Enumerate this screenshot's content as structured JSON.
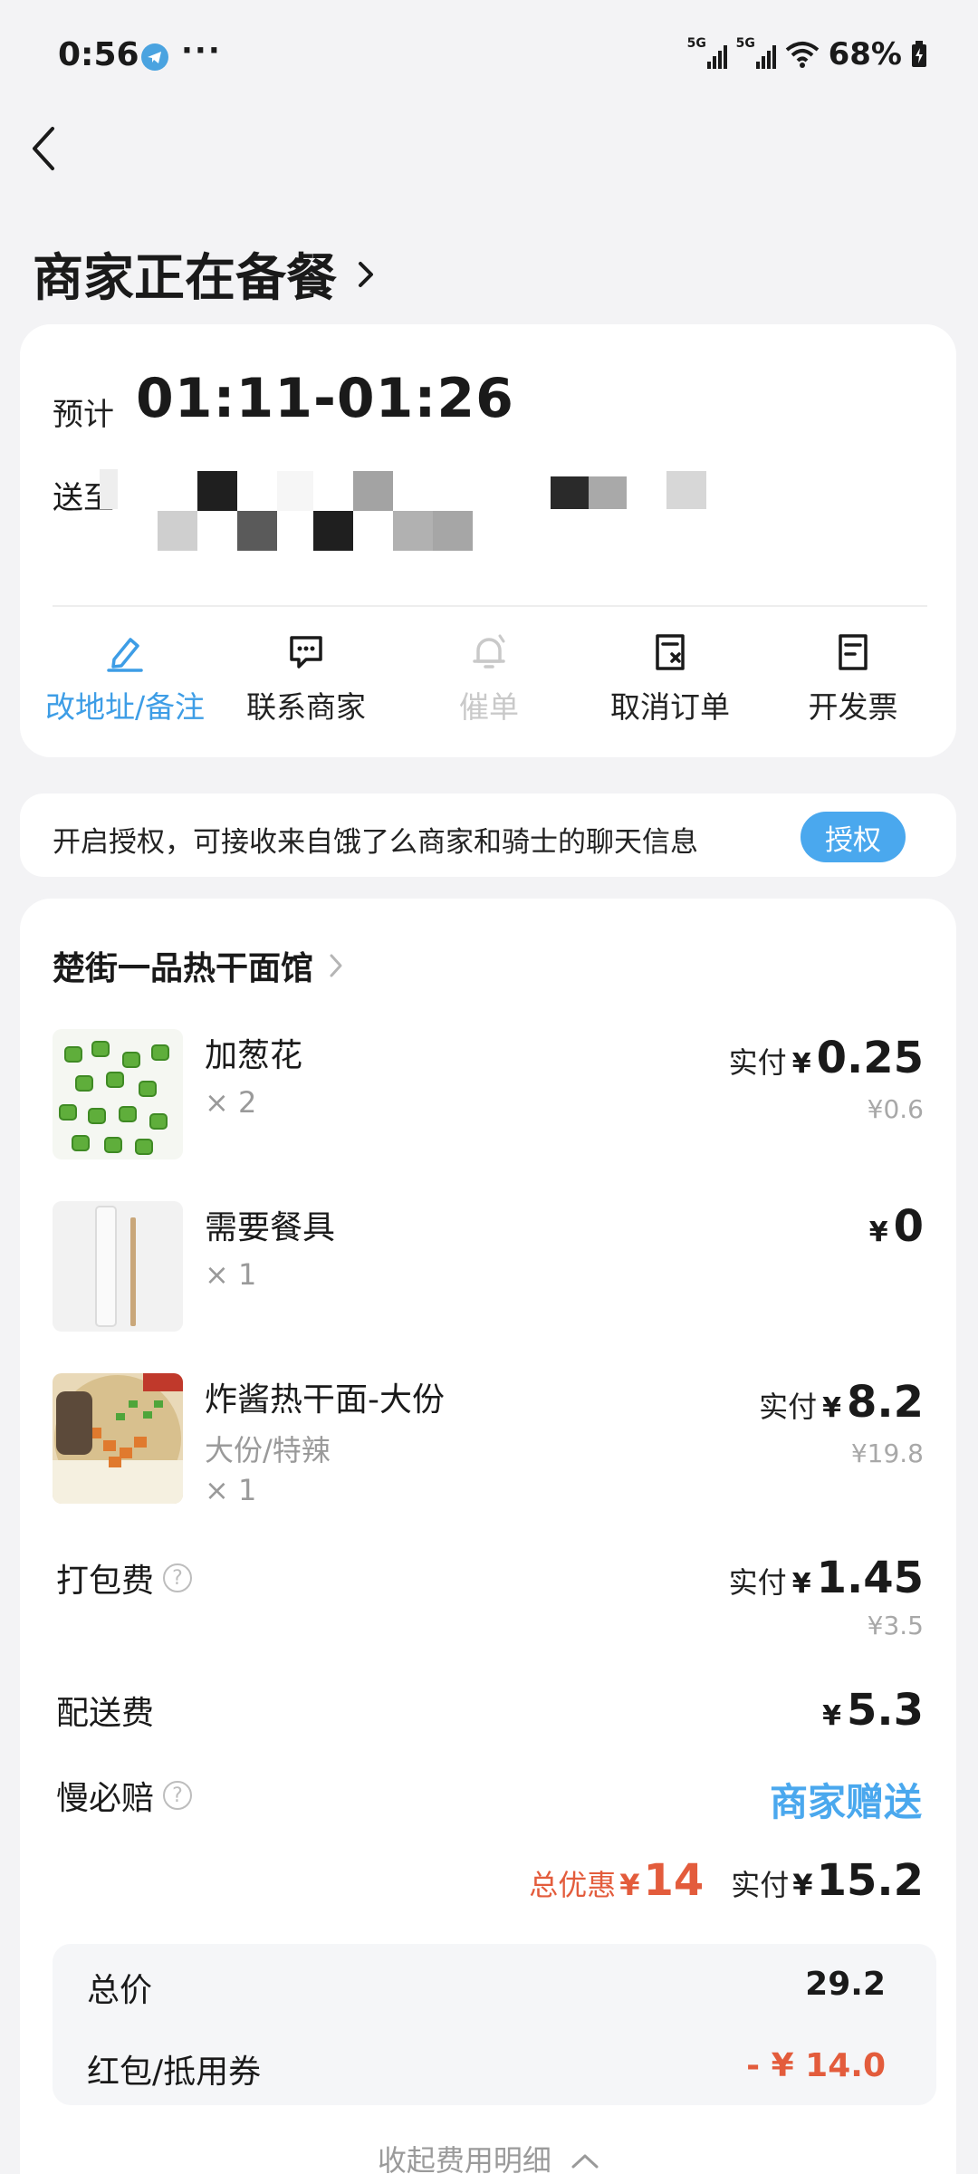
{
  "status_bar": {
    "time": "0:56",
    "more": "···",
    "signal1_tag": "5G",
    "signal2_tag": "5G",
    "battery": "68%",
    "icons": [
      "telegram-icon",
      "signal-icon",
      "wifi-icon",
      "battery-charging-icon"
    ]
  },
  "header": {
    "title": "商家正在备餐",
    "back_icon": "chevron-left-icon"
  },
  "delivery": {
    "eta_label": "预计",
    "eta_time": "01:11-01:26",
    "address_label": "送至"
  },
  "actions": [
    {
      "label": "改地址/备注",
      "icon": "edit-pen-icon",
      "state": "active"
    },
    {
      "label": "联系商家",
      "icon": "chat-icon",
      "state": "normal"
    },
    {
      "label": "催单",
      "icon": "bell-icon",
      "state": "disabled"
    },
    {
      "label": "取消订单",
      "icon": "cancel-doc-icon",
      "state": "normal"
    },
    {
      "label": "开发票",
      "icon": "invoice-icon",
      "state": "normal"
    }
  ],
  "auth": {
    "text": "开启授权，可接收来自饿了么商家和骑士的聊天信息",
    "button": "授权"
  },
  "shop": {
    "name": "楚街一品热干面馆"
  },
  "items": [
    {
      "name": "加葱花",
      "qty": "× 2",
      "pay_label": "实付",
      "currency": "¥",
      "price": "0.25",
      "original": "¥0.6"
    },
    {
      "name": "需要餐具",
      "qty": "× 1",
      "currency": "¥",
      "price": "0"
    },
    {
      "name": "炸酱热干面-大份",
      "spec": "大份/特辣",
      "qty": "× 1",
      "pay_label": "实付",
      "currency": "¥",
      "price": "8.2",
      "original": "¥19.8"
    }
  ],
  "fees": {
    "packing": {
      "label": "打包费",
      "pay_label": "实付",
      "currency": "¥",
      "price": "1.45",
      "original": "¥3.5"
    },
    "delivery": {
      "label": "配送费",
      "currency": "¥",
      "price": "5.3"
    },
    "late_comp": {
      "label": "慢必赔",
      "value": "商家赠送"
    },
    "help_icon": "?"
  },
  "summary": {
    "discount_label": "总优惠",
    "discount_currency": "¥",
    "discount_value": "14",
    "paid_label": "实付",
    "paid_currency": "¥",
    "paid_value": "15.2"
  },
  "breakdown": {
    "total_label": "总价",
    "total_value": "29.2",
    "coupon_label": "红包/抵用券",
    "coupon_value": "- ¥ 14.0"
  },
  "collapse": {
    "label": "收起费用明细"
  },
  "colors": {
    "accent": "#4aa8ee",
    "discount": "#e35c3c",
    "background": "#f3f3f5"
  }
}
